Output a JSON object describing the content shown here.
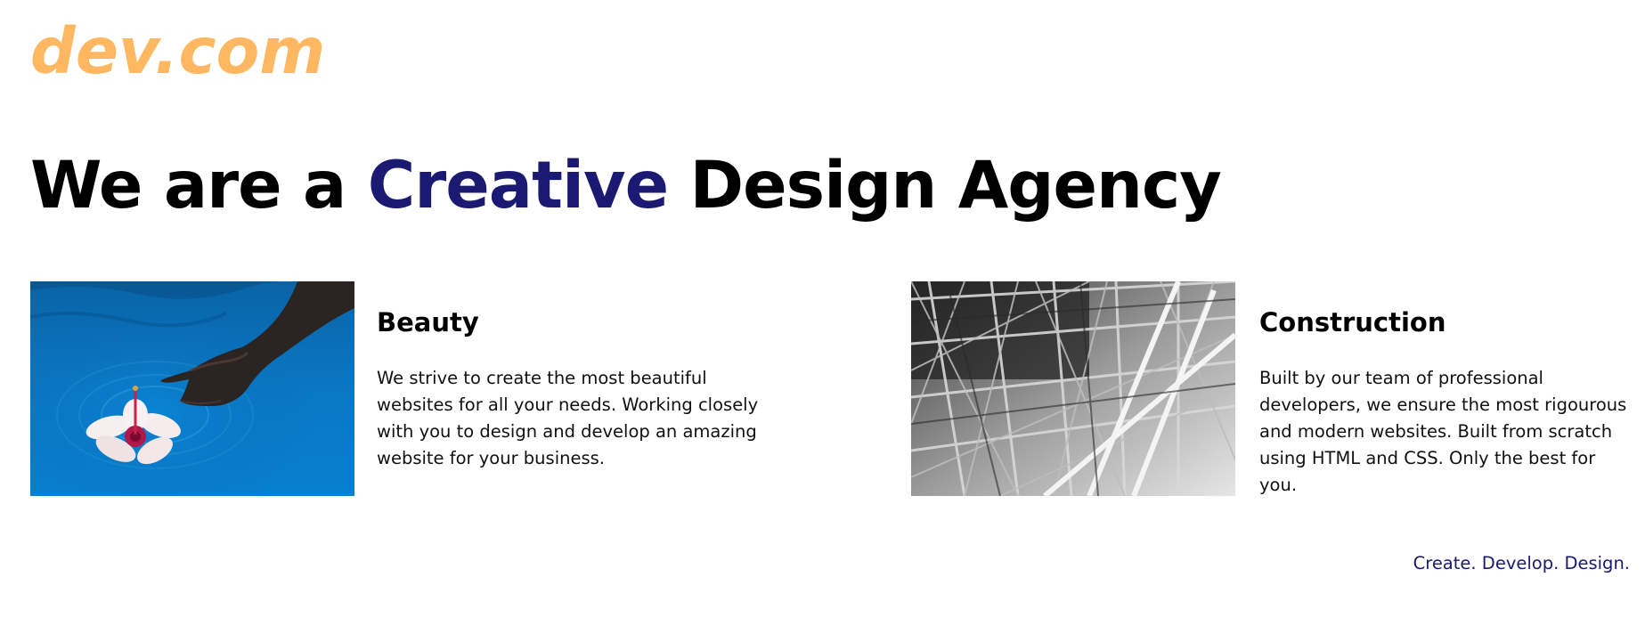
{
  "header": {
    "logo_text": "dev.com"
  },
  "hero": {
    "headline_before": "We are a ",
    "headline_accent": "Creative",
    "headline_after": " Design Agency"
  },
  "cards": [
    {
      "title": "Beauty",
      "text": "We strive to create the most beautiful websites for all your needs. Working closely with you to design and develop an amazing website for your business.",
      "image": "hand-flower-water-photo"
    },
    {
      "title": "Construction",
      "text": "Built by our team of professional developers, we ensure the most rigourous and modern websites. Built from scratch using HTML and CSS. Only the best for you.",
      "image": "steel-structure-photo"
    }
  ],
  "footer": {
    "tagline": "Create. Develop. Design."
  },
  "colors": {
    "logo": "#ffb861",
    "accent": "#1b1a73",
    "text": "#000000",
    "background": "#ffffff"
  }
}
